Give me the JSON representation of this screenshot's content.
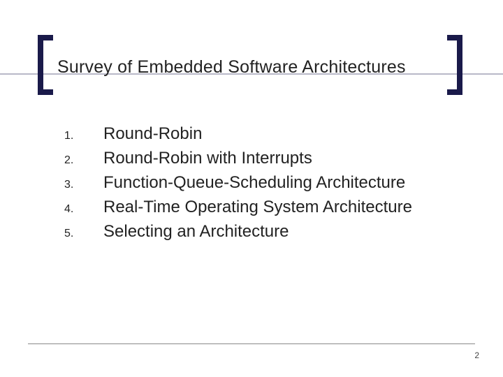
{
  "title": "Survey of Embedded Software Architectures",
  "items": [
    {
      "num": "1.",
      "text": "Round-Robin"
    },
    {
      "num": "2.",
      "text": "Round-Robin with Interrupts"
    },
    {
      "num": "3.",
      "text": "Function-Queue-Scheduling Architecture"
    },
    {
      "num": "4.",
      "text": "Real-Time Operating System Architecture"
    },
    {
      "num": "5.",
      "text": "Selecting an Architecture"
    }
  ],
  "page": "2"
}
